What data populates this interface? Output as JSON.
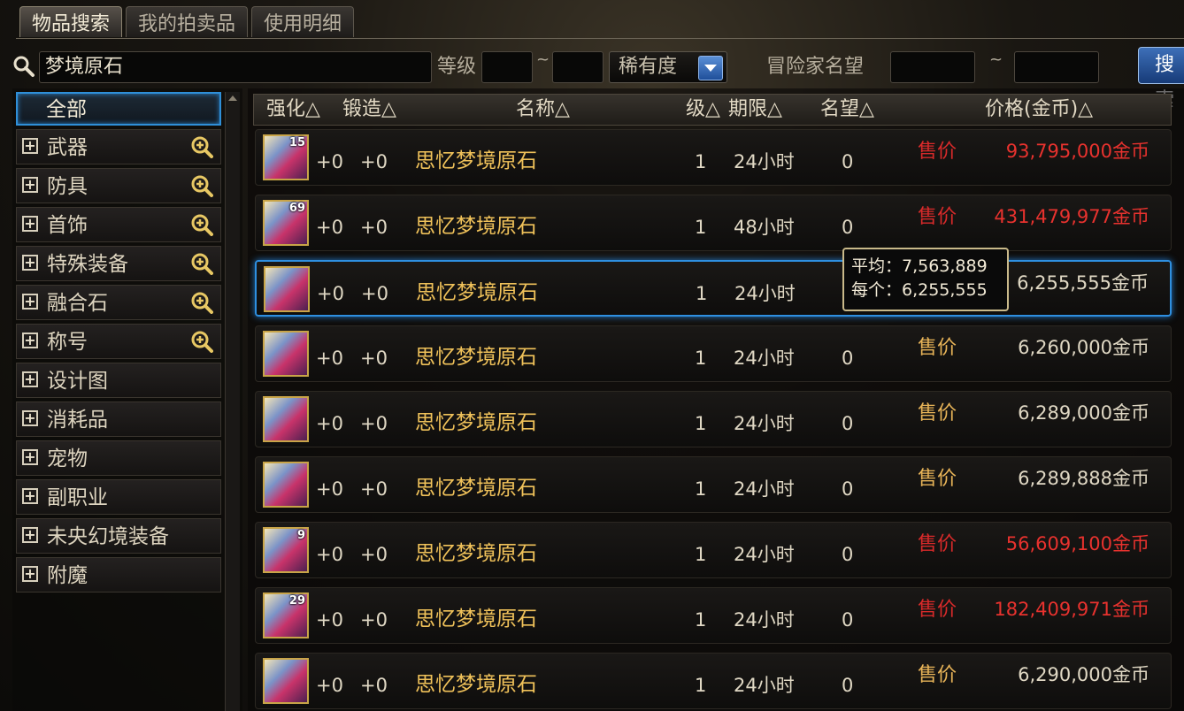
{
  "tabs": [
    "物品搜索",
    "我的拍卖品",
    "使用明细"
  ],
  "search": {
    "query": "梦境原石",
    "level_label": "等级",
    "level_sep": "~",
    "rarity_label": "稀有度",
    "fame_label": "冒险家名望",
    "fame_sep": "~",
    "button_label": "搜索"
  },
  "categories": [
    {
      "label": "全部"
    },
    {
      "label": "武器",
      "zoom": true
    },
    {
      "label": "防具",
      "zoom": true
    },
    {
      "label": "首饰",
      "zoom": true
    },
    {
      "label": "特殊装备",
      "zoom": true
    },
    {
      "label": "融合石",
      "zoom": true
    },
    {
      "label": "称号",
      "zoom": true
    },
    {
      "label": "设计图"
    },
    {
      "label": "消耗品"
    },
    {
      "label": "宠物"
    },
    {
      "label": "副职业"
    },
    {
      "label": "未央幻境装备"
    },
    {
      "label": "附魔"
    }
  ],
  "columns": [
    "强化△",
    "锻造△",
    "名称△",
    "级△",
    "期限△",
    "名望△",
    "价格(金币)△"
  ],
  "rows": [
    {
      "stack": "15",
      "enhance": "+0",
      "forge": "+0",
      "name": "思忆梦境原石",
      "level": "1",
      "duration": "24小时",
      "fame": "0",
      "tag": "售价",
      "price": "93,795,000金币",
      "red": true
    },
    {
      "stack": "69",
      "enhance": "+0",
      "forge": "+0",
      "name": "思忆梦境原石",
      "level": "1",
      "duration": "48小时",
      "fame": "0",
      "tag": "售价",
      "price": "431,479,977金币",
      "red": true
    },
    {
      "stack": "",
      "enhance": "+0",
      "forge": "+0",
      "name": "思忆梦境原石",
      "level": "1",
      "duration": "24小时",
      "fame": "0",
      "tag": "",
      "price": "6,255,555金币",
      "red": false
    },
    {
      "stack": "",
      "enhance": "+0",
      "forge": "+0",
      "name": "思忆梦境原石",
      "level": "1",
      "duration": "24小时",
      "fame": "0",
      "tag": "售价",
      "price": "6,260,000金币",
      "red": false
    },
    {
      "stack": "",
      "enhance": "+0",
      "forge": "+0",
      "name": "思忆梦境原石",
      "level": "1",
      "duration": "24小时",
      "fame": "0",
      "tag": "售价",
      "price": "6,289,000金币",
      "red": false
    },
    {
      "stack": "",
      "enhance": "+0",
      "forge": "+0",
      "name": "思忆梦境原石",
      "level": "1",
      "duration": "24小时",
      "fame": "0",
      "tag": "售价",
      "price": "6,289,888金币",
      "red": false
    },
    {
      "stack": "9",
      "enhance": "+0",
      "forge": "+0",
      "name": "思忆梦境原石",
      "level": "1",
      "duration": "24小时",
      "fame": "0",
      "tag": "售价",
      "price": "56,609,100金币",
      "red": true
    },
    {
      "stack": "29",
      "enhance": "+0",
      "forge": "+0",
      "name": "思忆梦境原石",
      "level": "1",
      "duration": "24小时",
      "fame": "0",
      "tag": "售价",
      "price": "182,409,971金币",
      "red": true
    },
    {
      "stack": "",
      "enhance": "+0",
      "forge": "+0",
      "name": "思忆梦境原石",
      "level": "1",
      "duration": "24小时",
      "fame": "0",
      "tag": "售价",
      "price": "6,290,000金币",
      "red": false
    }
  ],
  "tooltip": {
    "avg": "平均：7,563,889",
    "each": "每个：6,255,555"
  },
  "colors": {
    "gold_text": "#f0c25a",
    "red_price": "#e8322e",
    "select_blue": "#2e8fe0"
  }
}
